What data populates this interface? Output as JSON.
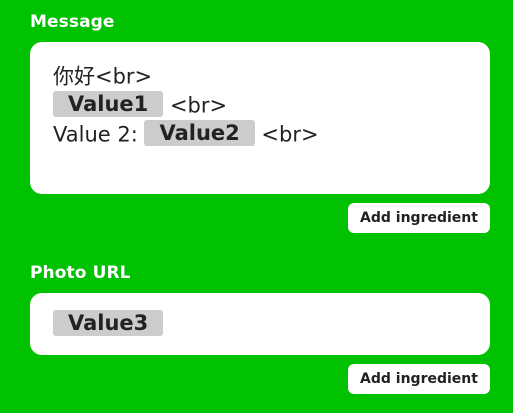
{
  "message": {
    "label": "Message",
    "line1_text": "你好<br>",
    "line2_pill": "Value1",
    "line2_text": " <br>",
    "line3_prefix": "Value 2: ",
    "line3_pill": "Value2",
    "line3_text": " <br>",
    "add_ingredient_label": "Add ingredient"
  },
  "photo_url": {
    "label": "Photo URL",
    "pill": "Value3",
    "add_ingredient_label": "Add ingredient"
  },
  "colors": {
    "background": "#00c200",
    "field_background": "#ffffff",
    "pill_background": "#cccccc",
    "text": "#222222"
  }
}
